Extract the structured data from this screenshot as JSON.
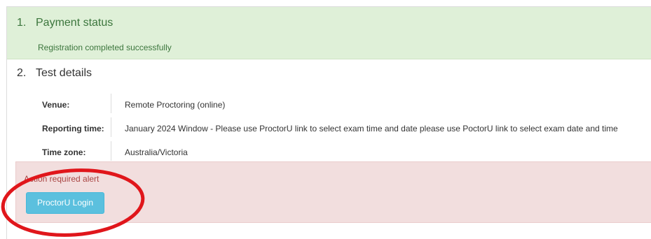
{
  "payment": {
    "number": "1.",
    "title": "Payment status",
    "message": "Registration completed successfully"
  },
  "test_details": {
    "number": "2.",
    "title": "Test details",
    "rows": [
      {
        "label": "Venue:",
        "value": "Remote Proctoring (online)"
      },
      {
        "label": "Reporting time:",
        "value": "January 2024 Window - Please use ProctorU link to select exam time and date please use PoctorU link to select exam date and time"
      },
      {
        "label": "Time zone:",
        "value": "Australia/Victoria"
      }
    ]
  },
  "alert": {
    "text": "Action required alert",
    "button_label": "ProctorU Login"
  },
  "colors": {
    "success_bg": "#dff0d8",
    "success_text": "#3c763d",
    "danger_bg": "#f2dede",
    "danger_text": "#a94442",
    "info_button": "#5bc0de",
    "annotation_circle": "#e0161b"
  }
}
